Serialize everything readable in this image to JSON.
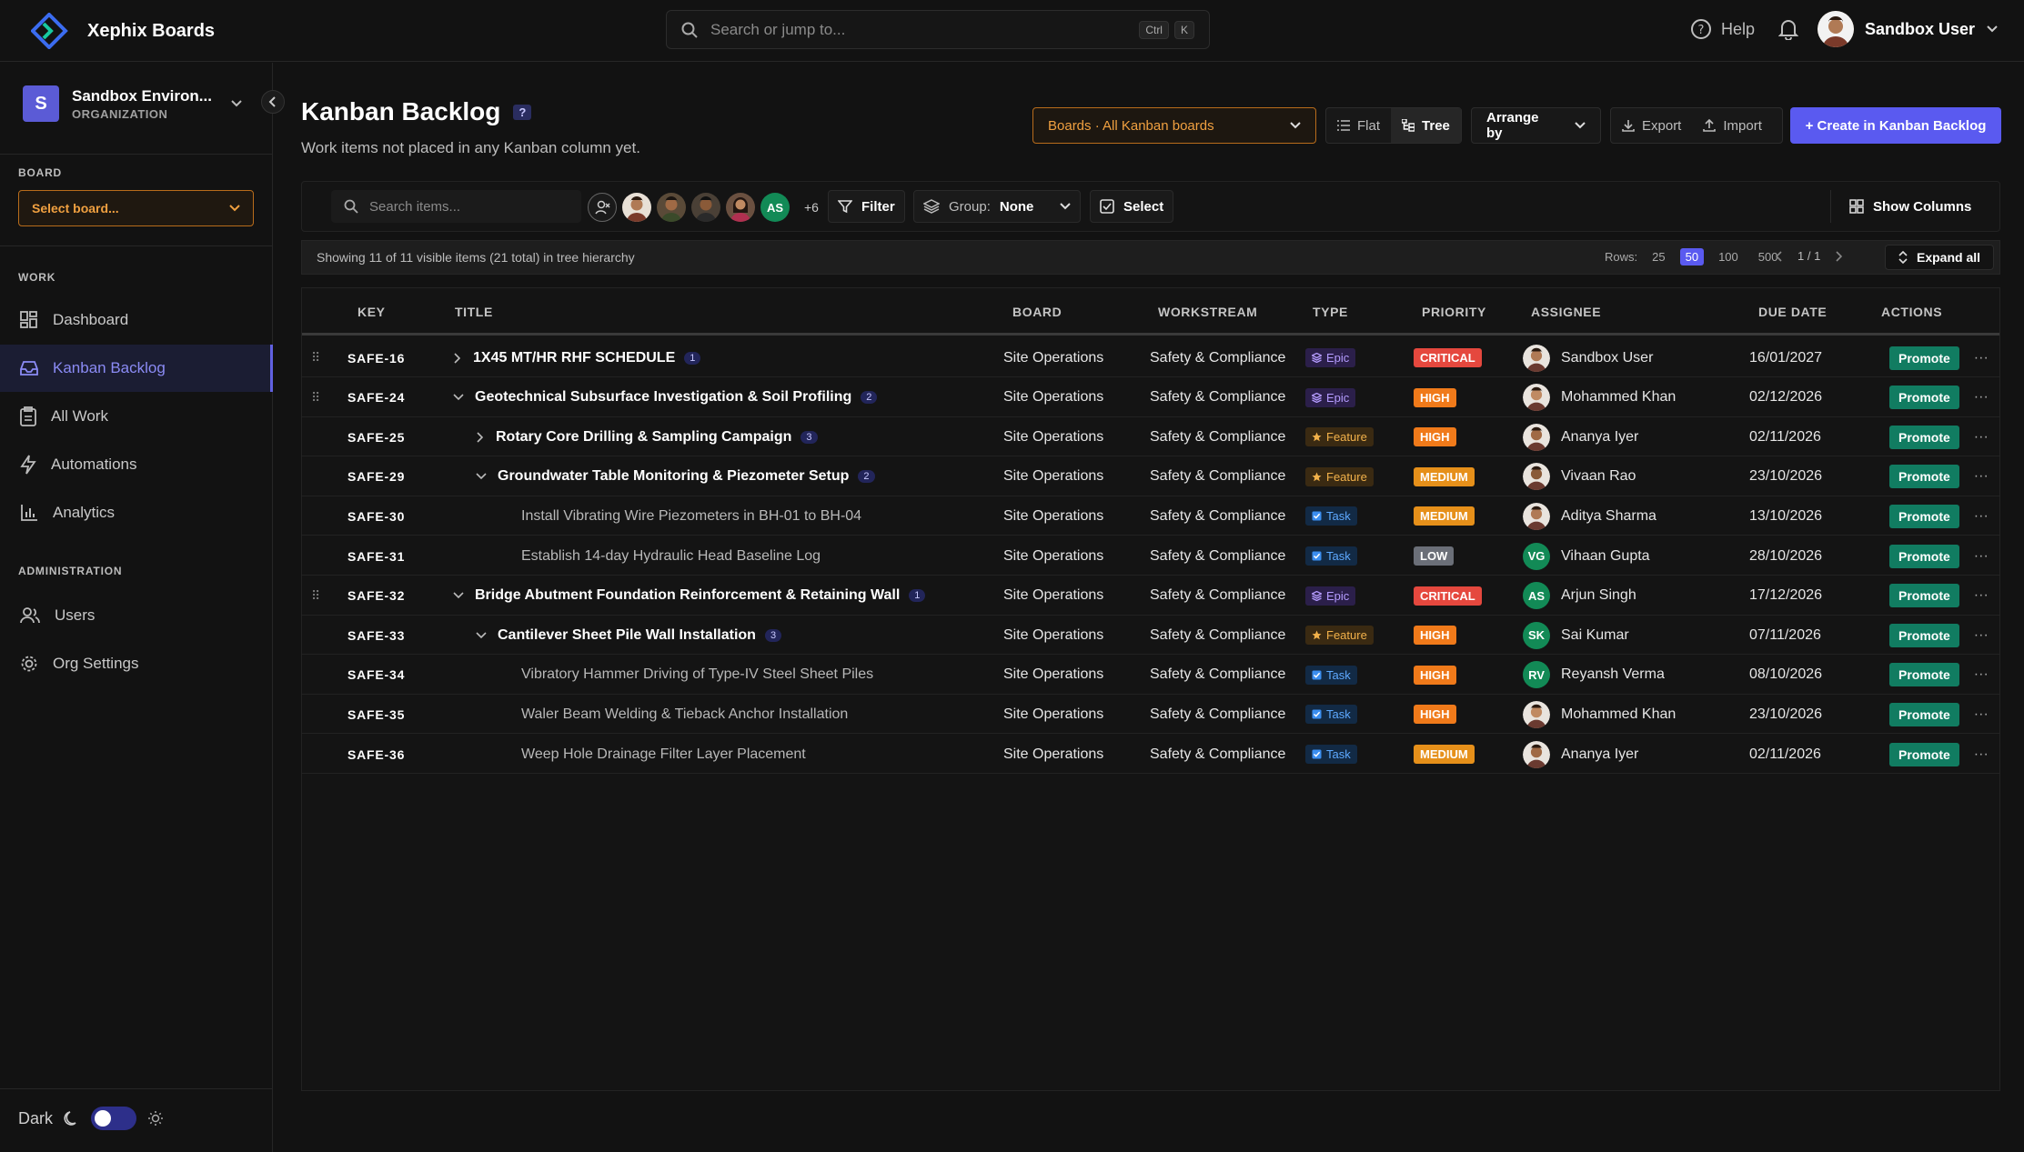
{
  "app": {
    "name": "Xephix Boards",
    "accent": "#5a5af0"
  },
  "search": {
    "placeholder": "Search or jump to...",
    "kbd1": "Ctrl",
    "kbd2": "K"
  },
  "header": {
    "help": "Help",
    "user": "Sandbox User"
  },
  "org": {
    "initial": "S",
    "name": "Sandbox Environ...",
    "type": "ORGANIZATION"
  },
  "sidebar": {
    "board_label": "BOARD",
    "board_select": "Select board...",
    "work_label": "WORK",
    "work_items": [
      {
        "label": "Dashboard",
        "icon": "dashboard-icon"
      },
      {
        "label": "Kanban Backlog",
        "icon": "inbox-icon",
        "active": true
      },
      {
        "label": "All Work",
        "icon": "clipboard-icon"
      },
      {
        "label": "Automations",
        "icon": "lightning-icon"
      },
      {
        "label": "Analytics",
        "icon": "bar-chart-icon"
      }
    ],
    "admin_label": "ADMINISTRATION",
    "admin_items": [
      {
        "label": "Users",
        "icon": "users-icon"
      },
      {
        "label": "Org Settings",
        "icon": "gear-icon"
      }
    ],
    "theme_label": "Dark"
  },
  "page": {
    "title": "Kanban Backlog",
    "help_badge": "?",
    "subtitle": "Work items not placed in any Kanban column yet.",
    "boards_dropdown": "Boards · All Kanban boards",
    "view_flat": "Flat",
    "view_tree": "Tree",
    "arrange": "Arrange by",
    "export": "Export",
    "import": "Import",
    "create": "+ Create in Kanban Backlog"
  },
  "toolbar": {
    "search_placeholder": "Search items...",
    "more_avatars": "+6",
    "filter": "Filter",
    "group_label": "Group:",
    "group_value": "None",
    "select": "Select",
    "show_columns": "Show Columns"
  },
  "status": {
    "info": "Showing 11 of 11 visible items (21 total) in tree hierarchy",
    "rows_label": "Rows:",
    "row_options": [
      "25",
      "50",
      "100",
      "500"
    ],
    "rows_selected": "50",
    "page": "1 / 1",
    "expand_all": "Expand all"
  },
  "columns": [
    "KEY",
    "TITLE",
    "BOARD",
    "WORKSTREAM",
    "TYPE",
    "PRIORITY",
    "ASSIGNEE",
    "DUE DATE",
    "ACTIONS"
  ],
  "rows": [
    {
      "key": "SAFE-16",
      "title": "1X45 MT/HR RHF SCHEDULE",
      "count": "1",
      "level": 0,
      "toggle": "collapsed",
      "grip": true,
      "style": "strong",
      "board": "Site Operations",
      "workstream": "Safety & Compliance",
      "type": "Epic",
      "priority": "CRITICAL",
      "assignee": "Sandbox User",
      "initials": "",
      "due": "16/01/2027",
      "action": "Promote"
    },
    {
      "key": "SAFE-24",
      "title": "Geotechnical Subsurface Investigation & Soil Profiling",
      "count": "2",
      "level": 0,
      "toggle": "expanded",
      "grip": true,
      "style": "strong",
      "board": "Site Operations",
      "workstream": "Safety & Compliance",
      "type": "Epic",
      "priority": "HIGH",
      "assignee": "Mohammed Khan",
      "initials": "",
      "due": "02/12/2026",
      "action": "Promote"
    },
    {
      "key": "SAFE-25",
      "title": "Rotary Core Drilling & Sampling Campaign",
      "count": "3",
      "level": 1,
      "toggle": "collapsed",
      "grip": false,
      "style": "strong",
      "board": "Site Operations",
      "workstream": "Safety & Compliance",
      "type": "Feature",
      "priority": "HIGH",
      "assignee": "Ananya Iyer",
      "initials": "",
      "due": "02/11/2026",
      "action": "Promote"
    },
    {
      "key": "SAFE-29",
      "title": "Groundwater Table Monitoring & Piezometer Setup",
      "count": "2",
      "level": 1,
      "toggle": "expanded",
      "grip": false,
      "style": "strong",
      "board": "Site Operations",
      "workstream": "Safety & Compliance",
      "type": "Feature",
      "priority": "MEDIUM",
      "assignee": "Vivaan Rao",
      "initials": "",
      "due": "23/10/2026",
      "action": "Promote"
    },
    {
      "key": "SAFE-30",
      "title": "Install Vibrating Wire Piezometers in BH-01 to BH-04",
      "count": "",
      "level": 2,
      "toggle": "none",
      "grip": false,
      "style": "muted",
      "board": "Site Operations",
      "workstream": "Safety & Compliance",
      "type": "Task",
      "priority": "MEDIUM",
      "assignee": "Aditya Sharma",
      "initials": "",
      "due": "13/10/2026",
      "action": "Promote"
    },
    {
      "key": "SAFE-31",
      "title": "Establish 14-day Hydraulic Head Baseline Log",
      "count": "",
      "level": 2,
      "toggle": "none",
      "grip": false,
      "style": "muted",
      "board": "Site Operations",
      "workstream": "Safety & Compliance",
      "type": "Task",
      "priority": "LOW",
      "assignee": "Vihaan Gupta",
      "initials": "VG",
      "due": "28/10/2026",
      "action": "Promote"
    },
    {
      "key": "SAFE-32",
      "title": "Bridge Abutment Foundation Reinforcement & Retaining Wall",
      "count": "1",
      "level": 0,
      "toggle": "expanded",
      "grip": true,
      "style": "strong",
      "board": "Site Operations",
      "workstream": "Safety & Compliance",
      "type": "Epic",
      "priority": "CRITICAL",
      "assignee": "Arjun Singh",
      "initials": "AS",
      "due": "17/12/2026",
      "action": "Promote"
    },
    {
      "key": "SAFE-33",
      "title": "Cantilever Sheet Pile Wall Installation",
      "count": "3",
      "level": 1,
      "toggle": "expanded",
      "grip": false,
      "style": "strong",
      "board": "Site Operations",
      "workstream": "Safety & Compliance",
      "type": "Feature",
      "priority": "HIGH",
      "assignee": "Sai Kumar",
      "initials": "SK",
      "due": "07/11/2026",
      "action": "Promote"
    },
    {
      "key": "SAFE-34",
      "title": "Vibratory Hammer Driving of Type-IV Steel Sheet Piles",
      "count": "",
      "level": 2,
      "toggle": "none",
      "grip": false,
      "style": "muted",
      "board": "Site Operations",
      "workstream": "Safety & Compliance",
      "type": "Task",
      "priority": "HIGH",
      "assignee": "Reyansh Verma",
      "initials": "RV",
      "due": "08/10/2026",
      "action": "Promote"
    },
    {
      "key": "SAFE-35",
      "title": "Waler Beam Welding & Tieback Anchor Installation",
      "count": "",
      "level": 2,
      "toggle": "none",
      "grip": false,
      "style": "muted",
      "board": "Site Operations",
      "workstream": "Safety & Compliance",
      "type": "Task",
      "priority": "HIGH",
      "assignee": "Mohammed Khan",
      "initials": "",
      "due": "23/10/2026",
      "action": "Promote"
    },
    {
      "key": "SAFE-36",
      "title": "Weep Hole Drainage Filter Layer Placement",
      "count": "",
      "level": 2,
      "toggle": "none",
      "grip": false,
      "style": "muted",
      "board": "Site Operations",
      "workstream": "Safety & Compliance",
      "type": "Task",
      "priority": "MEDIUM",
      "assignee": "Ananya Iyer",
      "initials": "",
      "due": "02/11/2026",
      "action": "Promote"
    }
  ],
  "colors": {
    "critical": "#e5483e",
    "high": "#f07a1a",
    "medium": "#e6901a",
    "low": "#6b6f78",
    "promote": "#117c61",
    "initials_bg": "#128a56"
  }
}
